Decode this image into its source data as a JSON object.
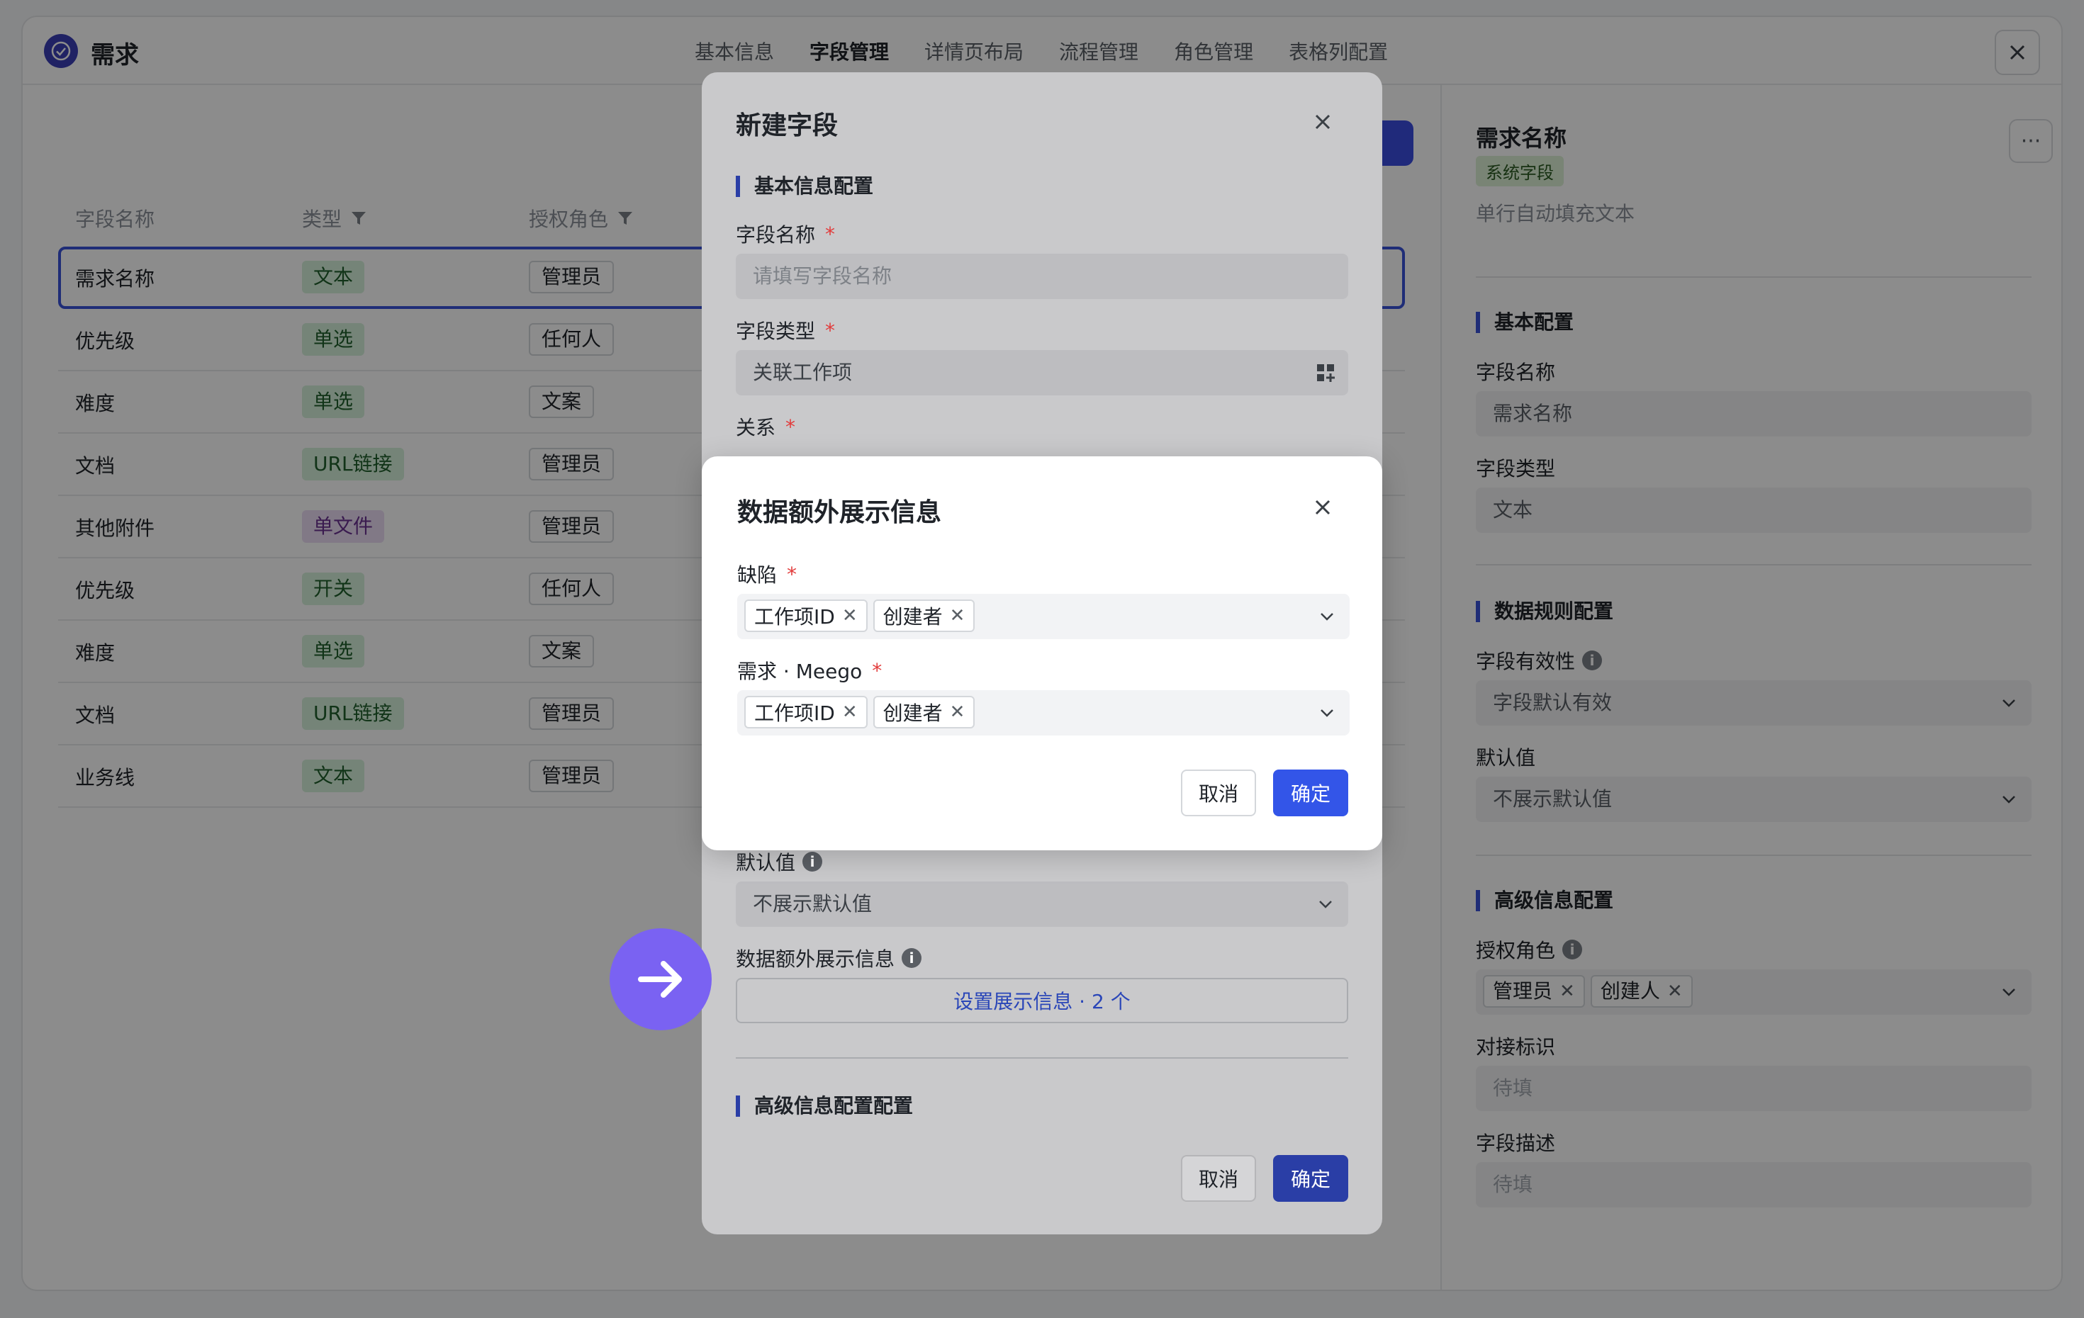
{
  "app": {
    "title": "需求"
  },
  "tabs": [
    "基本信息",
    "字段管理",
    "详情页布局",
    "流程管理",
    "角色管理",
    "表格列配置"
  ],
  "table": {
    "headers": {
      "name": "字段名称",
      "type": "类型",
      "role": "授权角色"
    },
    "rows": [
      {
        "name": "需求名称",
        "type": "文本",
        "role": "管理员",
        "type_color": "green"
      },
      {
        "name": "优先级",
        "type": "单选",
        "role": "任何人",
        "type_color": "green"
      },
      {
        "name": "难度",
        "type": "单选",
        "role": "文案",
        "type_color": "green"
      },
      {
        "name": "文档",
        "type": "URL链接",
        "role": "管理员",
        "type_color": "green"
      },
      {
        "name": "其他附件",
        "type": "单文件",
        "role": "管理员",
        "type_color": "purple"
      },
      {
        "name": "优先级",
        "type": "开关",
        "role": "任何人",
        "type_color": "green"
      },
      {
        "name": "难度",
        "type": "单选",
        "role": "文案",
        "type_color": "green"
      },
      {
        "name": "文档",
        "type": "URL链接",
        "role": "管理员",
        "type_color": "green"
      },
      {
        "name": "业务线",
        "type": "文本",
        "role": "管理员",
        "type_color": "green"
      }
    ]
  },
  "right_panel": {
    "title": "需求名称",
    "badge": "系统字段",
    "description": "单行自动填充文本",
    "more": "···",
    "basic": {
      "section": "基本配置",
      "name_label": "字段名称",
      "name_value": "需求名称",
      "type_label": "字段类型",
      "type_value": "文本"
    },
    "rules": {
      "section": "数据规则配置",
      "validity_label": "字段有效性",
      "validity_value": "字段默认有效",
      "default_label": "默认值",
      "default_value": "不展示默认值"
    },
    "advanced": {
      "section": "高级信息配置",
      "roles_label": "授权角色",
      "roles": [
        "管理员",
        "创建人"
      ],
      "ident_label": "对接标识",
      "ident_placeholder": "待填",
      "desc_label": "字段描述",
      "desc_placeholder": "待填"
    }
  },
  "modal_new_field": {
    "title": "新建字段",
    "section_basic": "基本信息配置",
    "name_label": "字段名称",
    "name_placeholder": "请填写字段名称",
    "type_label": "字段类型",
    "type_value": "关联工作项",
    "relation_label": "关系",
    "default_label": "默认值",
    "default_value": "不展示默认值",
    "extra_label": "数据额外展示信息",
    "extra_button": "设置展示信息 · 2 个",
    "section_advanced": "高级信息配置配置",
    "cancel": "取消",
    "confirm": "确定"
  },
  "modal_extra_info": {
    "title": "数据额外展示信息",
    "field1_label": "缺陷",
    "field1_chips": [
      "工作项ID",
      "创建者"
    ],
    "field2_label": "需求 · Meego",
    "field2_chips": [
      "工作项ID",
      "创建者"
    ],
    "cancel": "取消",
    "confirm": "确定"
  },
  "colors": {
    "primary": "#3355e8",
    "accent_purple": "#7a62f2",
    "tag_green_bg": "#d6f0da",
    "tag_purple_bg": "#ecdcf5"
  }
}
